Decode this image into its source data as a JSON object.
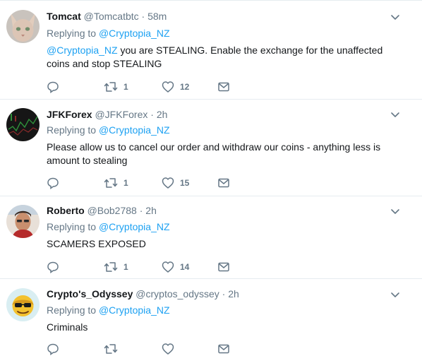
{
  "tweets": [
    {
      "name": "Tomcat",
      "handle": "@Tomcatbtc",
      "time": "58m",
      "replying_prefix": "Replying to",
      "replying_to": "@Cryptopia_NZ",
      "mention": "@Cryptopia_NZ",
      "text": " you are STEALING.  Enable the exchange for the unaffected coins and stop STEALING",
      "retweets": "1",
      "likes": "12",
      "avatar": "sphynx-cat"
    },
    {
      "name": "JFKForex",
      "handle": "@JFKForex",
      "time": "2h",
      "replying_prefix": "Replying to",
      "replying_to": "@Cryptopia_NZ",
      "text": "Please allow us to cancel our order and withdraw our coins - anything less is amount to stealing",
      "retweets": "1",
      "likes": "15",
      "avatar": "dark-chart"
    },
    {
      "name": "Roberto",
      "handle": "@Bob2788",
      "time": "2h",
      "replying_prefix": "Replying to",
      "replying_to": "@Cryptopia_NZ",
      "text": "SCAMERS EXPOSED",
      "retweets": "1",
      "likes": "14",
      "avatar": "man-photo"
    },
    {
      "name": "Crypto's_Odyssey",
      "handle": "@cryptos_odyssey",
      "time": "2h",
      "replying_prefix": "Replying to",
      "replying_to": "@Cryptopia_NZ",
      "text": "Criminals",
      "avatar": "sunglasses-cartoon"
    }
  ],
  "separator": "·",
  "colors": {
    "link": "#1da1f2",
    "muted": "#657786",
    "text": "#14171a",
    "divider": "#e6ecf0"
  }
}
